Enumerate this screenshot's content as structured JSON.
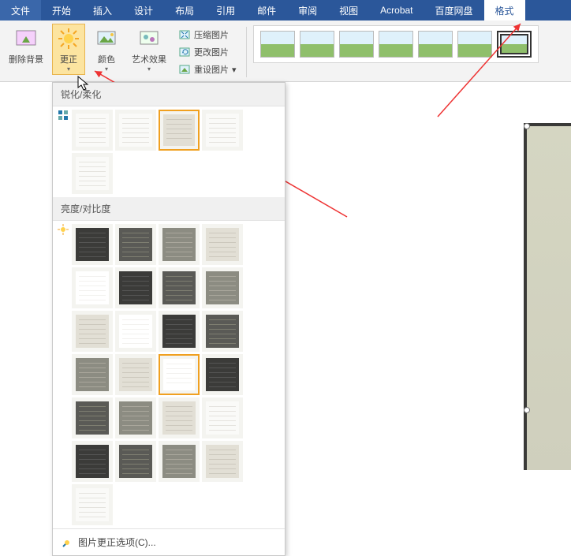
{
  "menubar": {
    "items": [
      {
        "label": "文件"
      },
      {
        "label": "开始"
      },
      {
        "label": "插入"
      },
      {
        "label": "设计"
      },
      {
        "label": "布局"
      },
      {
        "label": "引用"
      },
      {
        "label": "邮件"
      },
      {
        "label": "审阅"
      },
      {
        "label": "视图"
      },
      {
        "label": "Acrobat"
      },
      {
        "label": "百度网盘"
      },
      {
        "label": "格式"
      }
    ],
    "active_index": 11
  },
  "ribbon": {
    "remove_bg": "删除背景",
    "corrections": "更正",
    "color": "颜色",
    "artistic": "艺术效果",
    "compress": "压缩图片",
    "change": "更改图片",
    "reset": "重设图片"
  },
  "dropdown": {
    "section1_title": "锐化/柔化",
    "section2_title": "亮度/对比度",
    "footer_label": "图片更正选项(C)..."
  },
  "colors": {
    "ribbon_bg": "#2b579a",
    "highlight": "#fce4a0"
  }
}
